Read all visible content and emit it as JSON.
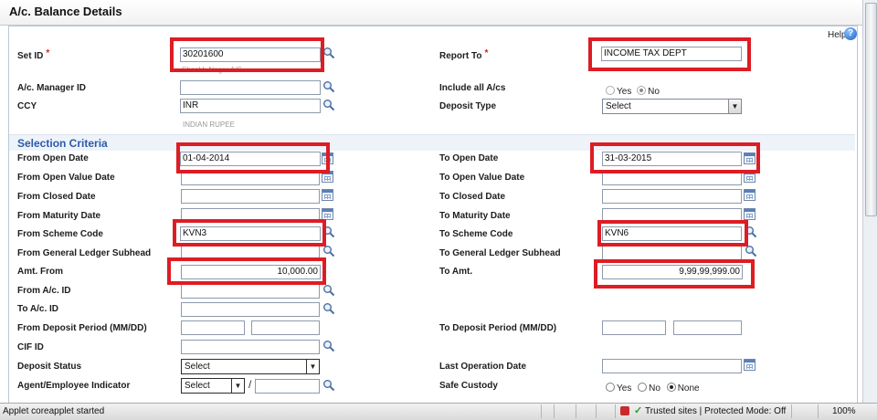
{
  "window": {
    "title": "A/c. Balance Details"
  },
  "help": {
    "label": "Help",
    "icon": "help-icon"
  },
  "header_fields": {
    "set_id": {
      "label": "Set ID",
      "required": "*",
      "value": "30201600",
      "hint": "Shankh Nagar A/S"
    },
    "report_to": {
      "label": "Report To",
      "required": "*",
      "value": "INCOME TAX DEPT"
    },
    "ac_manager_id": {
      "label": "A/c. Manager ID",
      "value": ""
    },
    "include_all_acs": {
      "label": "Include all A/cs",
      "options": [
        "Yes",
        "No"
      ],
      "selected": "No"
    },
    "ccy": {
      "label": "CCY",
      "value": "INR",
      "hint": "INDIAN RUPEE"
    },
    "deposit_type": {
      "label": "Deposit Type",
      "value": "Select"
    }
  },
  "section": {
    "title": "Selection Criteria"
  },
  "criteria": {
    "from_open_date": {
      "label": "From Open Date",
      "value": "01-04-2014"
    },
    "to_open_date": {
      "label": "To Open Date",
      "value": "31-03-2015"
    },
    "from_open_value_date": {
      "label": "From Open Value Date",
      "value": ""
    },
    "to_open_value_date": {
      "label": "To Open Value Date",
      "value": ""
    },
    "from_closed_date": {
      "label": "From Closed Date",
      "value": ""
    },
    "to_closed_date": {
      "label": "To Closed Date",
      "value": ""
    },
    "from_maturity_date": {
      "label": "From Maturity Date",
      "value": ""
    },
    "to_maturity_date": {
      "label": "To Maturity Date",
      "value": ""
    },
    "from_scheme_code": {
      "label": "From Scheme Code",
      "value": "KVN3"
    },
    "to_scheme_code": {
      "label": "To Scheme Code",
      "value": "KVN6"
    },
    "from_gl_subhead": {
      "label": "From General Ledger Subhead",
      "value": ""
    },
    "to_gl_subhead": {
      "label": "To General Ledger Subhead",
      "value": ""
    },
    "amt_from": {
      "label": "Amt. From",
      "value": "10,000.00"
    },
    "to_amt": {
      "label": "To Amt.",
      "value": "9,99,99,999.00"
    },
    "from_ac_id": {
      "label": "From A/c. ID",
      "value": ""
    },
    "to_ac_id": {
      "label": "To A/c. ID",
      "value": ""
    },
    "from_deposit_period": {
      "label": "From Deposit Period (MM/DD)",
      "months": "",
      "days": ""
    },
    "to_deposit_period": {
      "label": "To Deposit Period (MM/DD)",
      "months": "",
      "days": ""
    },
    "cif_id": {
      "label": "CIF ID",
      "value": ""
    },
    "deposit_status": {
      "label": "Deposit Status",
      "value": "Select"
    },
    "last_operation_date": {
      "label": "Last Operation Date",
      "value": ""
    },
    "agent_employee_indicator": {
      "label": "Agent/Employee Indicator",
      "value": "Select",
      "separator": "/"
    },
    "safe_custody": {
      "label": "Safe Custody",
      "options": [
        "Yes",
        "No",
        "None"
      ],
      "selected": "None"
    }
  },
  "status_bar": {
    "message": "Applet coreapplet started",
    "zone": "Trusted sites | Protected Mode: Off",
    "zoom": "100%"
  },
  "colors": {
    "highlight": "#dd1c24",
    "section_text": "#2d5aa8",
    "required": "#d21f1f"
  }
}
